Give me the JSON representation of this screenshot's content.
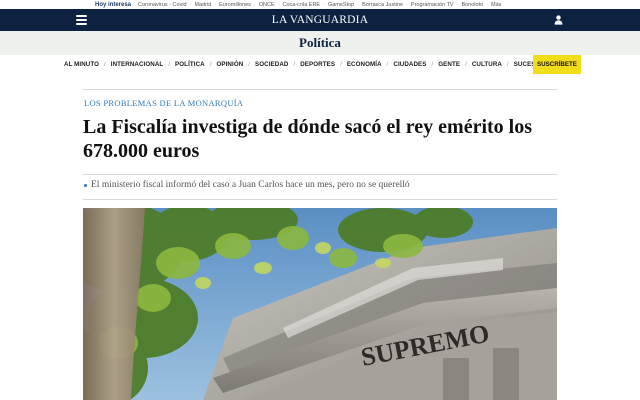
{
  "trending": {
    "lead": "Hoy interesa",
    "items": [
      "Coronavirus - Covid",
      "Madrid",
      "Euromillones",
      "ONCE",
      "Coca-cola ERE",
      "GameStop",
      "Borrasca Justine",
      "Programación TV",
      "Bonoloto",
      "Más"
    ]
  },
  "header": {
    "logo": "LA VANGUARDIA",
    "menu_icon": "hamburger-menu-icon",
    "user_icon": "user-icon"
  },
  "section": {
    "title": "Política"
  },
  "nav": {
    "items": [
      "AL MINUTO",
      "INTERNACIONAL",
      "POLÍTICA",
      "OPINIÓN",
      "SOCIEDAD",
      "DEPORTES",
      "ECONOMÍA",
      "CIUDADES",
      "GENTE",
      "CULTURA",
      "SUCESOS"
    ],
    "subscribe_label": "SUSCRÍBETE"
  },
  "article": {
    "kicker": "LOS PROBLEMAS DE LA MONARQUÍA",
    "headline": "La Fiscalía investiga de dónde sacó el rey emérito los 678.000 euros",
    "summary": "El ministerio fiscal informó del caso a Juan Carlos hace un mes, pero no se querelló",
    "photo_inscription": "SUPREMO"
  },
  "colors": {
    "navy": "#0d2140",
    "kicker_blue": "#2f7bbd",
    "subscribe_yellow": "#f3dc1a",
    "section_bg": "#eef1ee"
  }
}
